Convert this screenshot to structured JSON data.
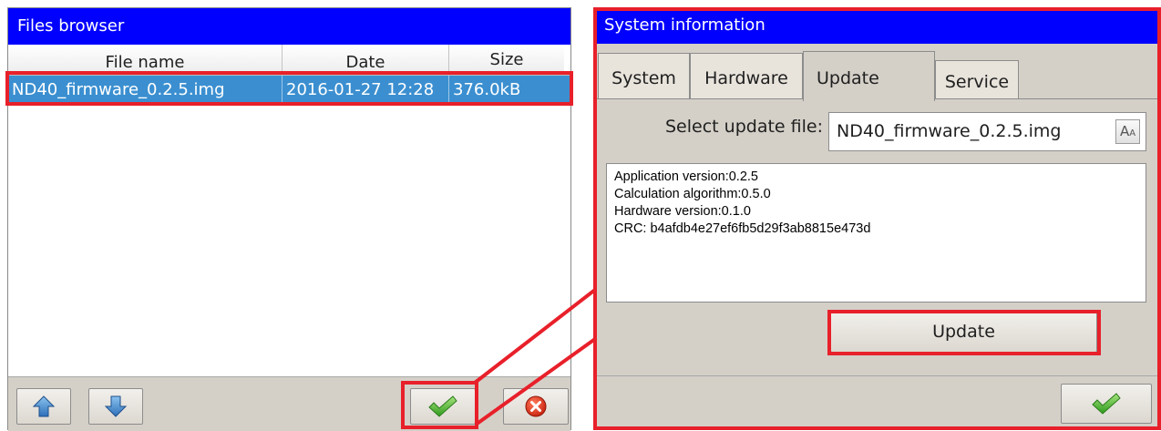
{
  "files_browser": {
    "title": "Files browser",
    "columns": [
      "File name",
      "Date",
      "Size"
    ],
    "rows": [
      {
        "name": "ND40_firmware_0.2.5.img",
        "date": "2016-01-27 12:28",
        "size": "376.0kB",
        "selected": true
      }
    ],
    "buttons": {
      "up": "arrow-up-icon",
      "down": "arrow-down-icon",
      "ok": "checkmark-icon",
      "cancel": "cancel-icon"
    }
  },
  "system_information": {
    "title": "System information",
    "tabs": [
      "System",
      "Hardware",
      "Update",
      "Service"
    ],
    "active_tab": "Update",
    "select_label": "Select update file:",
    "selected_file": "ND40_firmware_0.2.5.img",
    "keyboard_icon_text": "A",
    "keyboard_icon_small": "A",
    "info_lines": [
      "Application version:0.2.5",
      "Calculation algorithm:0.5.0",
      "Hardware version:0.1.0",
      "CRC: b4afdb4e27ef6fb5d29f3ab8815e473d"
    ],
    "update_button": "Update"
  },
  "colors": {
    "titlebar": "#0000ff",
    "selection": "#3b8fd0",
    "highlight": "#e8202a",
    "panel": "#d4d0c8"
  }
}
